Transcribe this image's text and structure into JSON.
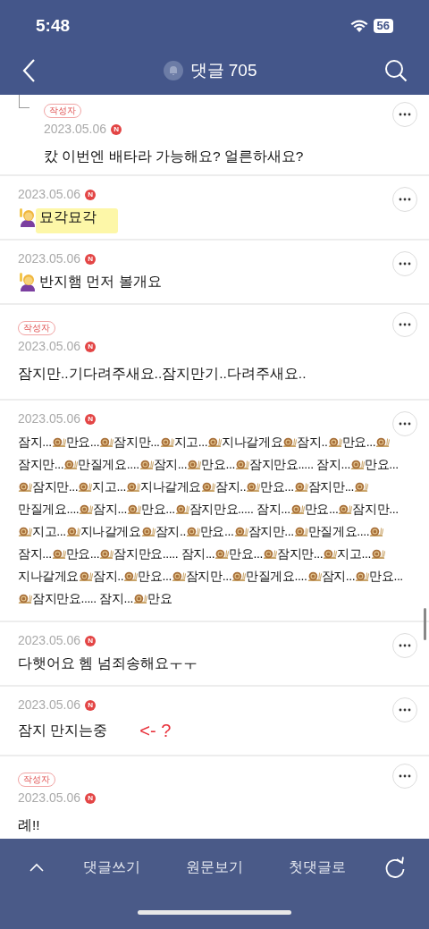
{
  "status_bar": {
    "time": "5:48",
    "battery": "56"
  },
  "header": {
    "title": "댓글 705"
  },
  "comments": [
    {
      "reply": true,
      "author_badge": "작성자",
      "date": "2023.05.06",
      "new_badge": "N",
      "has_emoji": false,
      "highlighted": false,
      "text": "캈 이번엔 배타라 가능해요? 얼른하새요?"
    },
    {
      "reply": false,
      "date": "2023.05.06",
      "new_badge": "N",
      "has_emoji": true,
      "highlighted": true,
      "text": "묘각묘각"
    },
    {
      "reply": false,
      "date": "2023.05.06",
      "new_badge": "N",
      "has_emoji": true,
      "highlighted": false,
      "text": "반지햄 먼저 볼개요"
    },
    {
      "reply": false,
      "author_badge": "작성자",
      "date": "2023.05.06",
      "new_badge": "N",
      "has_emoji": false,
      "highlighted": false,
      "text": "잠지만..기다려주새요..잠지만기..다려주새요.."
    },
    {
      "reply": false,
      "date": "2023.05.06",
      "new_badge": "N",
      "has_emoji": false,
      "highlighted": false,
      "parts": [
        "잠지...",
        "만요...",
        "잠지만...",
        "지고...",
        "지나갈게요",
        "잠지..",
        "만요...",
        "잠지만...",
        "만질게요....",
        "잠지...",
        "만요...",
        "잠지만요..... 잠지...",
        "만요...",
        "잠지만...",
        "지고...",
        "지나갈게요",
        "잠지..",
        "만요...",
        "잠지만...",
        "만질게요....",
        "잠지...",
        "만요...",
        "잠지만요..... 잠지...",
        "만요...",
        "잠지만...",
        "지고...",
        "지나갈게요",
        "잠지..",
        "만요...",
        "잠지만...",
        "만질게요....",
        "잠지...",
        "만요...",
        "잠지만요..... 잠지...",
        "만요...",
        "잠지만...",
        "지고...",
        "지나갈게요",
        "잠지..",
        "만요...",
        "잠지만...",
        "만질게요....",
        "잠지...",
        "만요...",
        "잠지만요..... 잠지...",
        "만요"
      ]
    },
    {
      "reply": false,
      "date": "2023.05.06",
      "new_badge": "N",
      "has_emoji": false,
      "highlighted": false,
      "text": "다햇어요 헴 넘죄송해요ㅜㅜ"
    },
    {
      "reply": false,
      "date": "2023.05.06",
      "new_badge": "N",
      "has_emoji": false,
      "highlighted": false,
      "text": "잠지 만지는중",
      "annotation": "<- ?"
    },
    {
      "reply": false,
      "author_badge": "작성자",
      "date": "2023.05.06",
      "new_badge": "N",
      "has_emoji": false,
      "highlighted": false,
      "text": "례!!"
    }
  ],
  "bottom_bar": {
    "items": [
      "댓글쓰기",
      "원문보기",
      "첫댓글로"
    ]
  }
}
